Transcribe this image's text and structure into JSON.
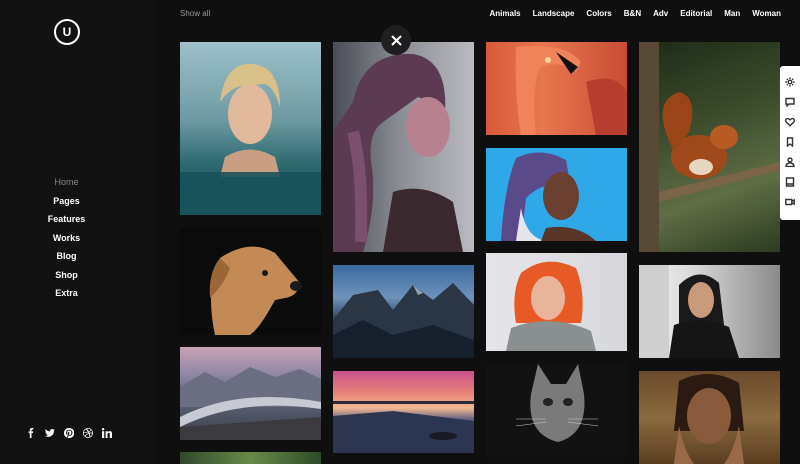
{
  "logo": {
    "letter": "U"
  },
  "nav": {
    "items": [
      "Home",
      "Pages",
      "Features",
      "Works",
      "Blog",
      "Shop",
      "Extra"
    ]
  },
  "social": {
    "icons": [
      "facebook-icon",
      "twitter-icon",
      "pinterest-icon",
      "dribbble-icon",
      "linkedin-icon"
    ]
  },
  "topbar": {
    "show_all": "Show all",
    "filters": [
      "Animals",
      "Landscape",
      "Colors",
      "B&N",
      "Adv",
      "Editorial",
      "Man",
      "Woman"
    ]
  },
  "gallery": {
    "tiles": [
      {
        "name": "photo-woman-swimming",
        "desc": "woman in water"
      },
      {
        "name": "photo-woman-braid",
        "desc": "woman braid portrait"
      },
      {
        "name": "photo-flamingo",
        "desc": "flamingos"
      },
      {
        "name": "photo-squirrel",
        "desc": "squirrel on branch"
      },
      {
        "name": "photo-woman-headscarf",
        "desc": "woman headscarf"
      },
      {
        "name": "photo-dog",
        "desc": "dog portrait"
      },
      {
        "name": "photo-mountains-night",
        "desc": "mountains"
      },
      {
        "name": "photo-woman-red-hair",
        "desc": "red hair woman"
      },
      {
        "name": "photo-woman-black-sweater",
        "desc": "woman black sweater"
      },
      {
        "name": "photo-glacier",
        "desc": "glacier valley"
      },
      {
        "name": "photo-sunset-beach",
        "desc": "sunset beach"
      },
      {
        "name": "photo-cat-bw",
        "desc": "cat black and white"
      },
      {
        "name": "photo-woman-hands-face",
        "desc": "woman hands face"
      }
    ]
  },
  "rightbar": {
    "icons": [
      "gear-icon",
      "comment-icon",
      "heart-icon",
      "bookmark-icon",
      "user-icon",
      "book-icon",
      "video-icon"
    ]
  },
  "colors": {
    "background": "#0f0f0f",
    "sidebar": "#121213",
    "text": "#ffffff",
    "muted": "#8a8a8a"
  }
}
